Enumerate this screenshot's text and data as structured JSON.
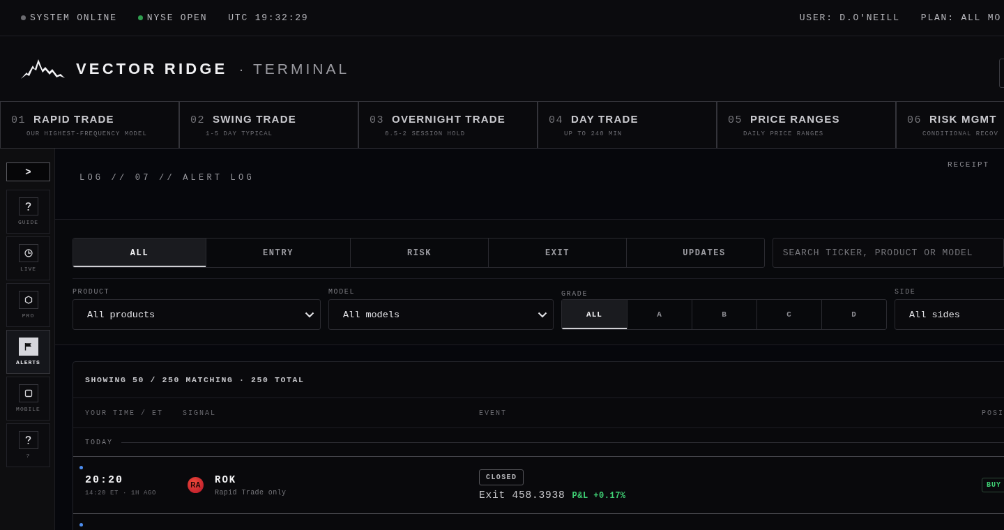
{
  "status_bar": {
    "items": [
      {
        "label": "SYSTEM ONLINE",
        "color": "#6b6b70"
      },
      {
        "label": "NYSE OPEN",
        "color": "#2f9e4f"
      }
    ],
    "clock": "UTC 19:32:29",
    "user": "USER: D.O'NEILL",
    "plan": "PLAN: ALL MO"
  },
  "brand": {
    "name": "VECTOR RIDGE",
    "suffix": "· TERMINAL"
  },
  "model_tabs": [
    {
      "number": "01",
      "title": "RAPID TRADE",
      "subtitle": "OUR HIGHEST-FREQUENCY MODEL"
    },
    {
      "number": "02",
      "title": "SWING TRADE",
      "subtitle": "1-5 DAY TYPICAL"
    },
    {
      "number": "03",
      "title": "OVERNIGHT TRADE",
      "subtitle": "0.5-2 SESSION HOLD"
    },
    {
      "number": "04",
      "title": "DAY TRADE",
      "subtitle": "UP TO 240 MIN"
    },
    {
      "number": "05",
      "title": "PRICE RANGES",
      "subtitle": "DAILY PRICE RANGES"
    },
    {
      "number": "06",
      "title": "RISK MGMT",
      "subtitle": "CONDITIONAL RECOV"
    }
  ],
  "sidebar": {
    "toggle": ">",
    "items": [
      {
        "kind": "question",
        "label": "GUIDE",
        "selected": false
      },
      {
        "kind": "clock",
        "label": "LIVE",
        "selected": false
      },
      {
        "kind": "hexagon",
        "label": "PRO",
        "selected": false
      },
      {
        "kind": "flag",
        "label": "ALERTS",
        "selected": true
      },
      {
        "kind": "square",
        "label": "MOBILE",
        "selected": false
      },
      {
        "kind": "question",
        "label": "?",
        "selected": false
      }
    ]
  },
  "section": {
    "breadcrumb": "LOG // 07 // ALERT LOG",
    "link": "RECEIPT"
  },
  "filter_tabs": [
    {
      "label": "ALL",
      "selected": true
    },
    {
      "label": "ENTRY",
      "selected": false
    },
    {
      "label": "RISK",
      "selected": false
    },
    {
      "label": "EXIT",
      "selected": false
    },
    {
      "label": "UPDATES",
      "selected": false
    }
  ],
  "search": {
    "placeholder": "SEARCH TICKER, PRODUCT OR MODEL"
  },
  "filters": {
    "product": {
      "label": "PRODUCT",
      "value": "All products"
    },
    "model": {
      "label": "MODEL",
      "value": "All models"
    },
    "grade": {
      "label": "GRADE",
      "options": [
        {
          "label": "ALL",
          "selected": true
        },
        {
          "label": "A",
          "selected": false
        },
        {
          "label": "B",
          "selected": false
        },
        {
          "label": "C",
          "selected": false
        },
        {
          "label": "D",
          "selected": false
        }
      ]
    },
    "side": {
      "label": "SIDE",
      "value": "All sides"
    }
  },
  "results": {
    "summary": "SHOWING 50 / 250 MATCHING · 250 TOTAL",
    "columns": [
      "YOUR TIME / ET",
      "SIGNAL",
      "EVENT",
      "POSI"
    ],
    "group": "TODAY",
    "rows": [
      {
        "unread": true,
        "time": "20:20",
        "time_detail": "14:20 ET · 1H AGO",
        "logo_text": "RA",
        "ticker": "ROK",
        "model": "Rapid Trade only",
        "badge": "CLOSED",
        "event": "Exit 458.3938",
        "pnl": "P&L +0.17%",
        "position": "BUY"
      },
      {
        "unread": true
      }
    ]
  }
}
